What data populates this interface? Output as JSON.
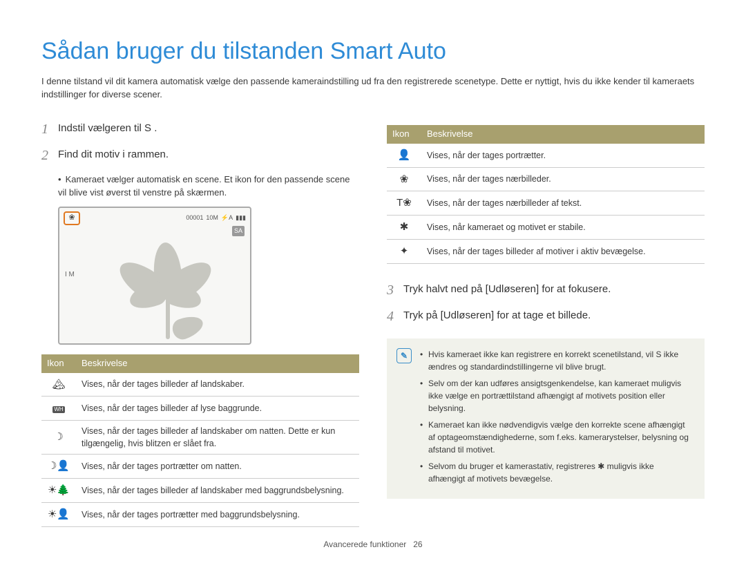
{
  "title": "Sådan bruger du tilstanden Smart Auto",
  "intro": "I denne tilstand vil dit kamera automatisk vælge den passende kameraindstilling ud fra den registrerede scenetype. Dette er nyttigt, hvis du ikke kender til kameraets indstillinger for diverse scener.",
  "steps": {
    "s1": {
      "num": "1",
      "text": "Indstil vælgeren til  S .",
      "mode_icon": "S"
    },
    "s2": {
      "num": "2",
      "text": "Find dit motiv i rammen."
    },
    "s2_bullet": "Kameraet vælger automatisk en scene. Et ikon for den passende scene vil blive vist øverst til venstre på skærmen.",
    "s3": {
      "num": "3",
      "text": "Tryk halvt ned på [Udløseren] for at fokusere."
    },
    "s4": {
      "num": "4",
      "text": "Tryk på [Udløseren] for at tage et billede."
    }
  },
  "preview": {
    "macro_glyph": "❀",
    "counter": "00001",
    "res": "10M",
    "flash": "⚡A",
    "battery": "▮▮▮",
    "sa": "SA",
    "leftmark": "I M"
  },
  "table_header": {
    "icon": "Ikon",
    "desc": "Beskrivelse"
  },
  "left_table": [
    {
      "icon": "🏔",
      "name": "landscape-icon",
      "desc": "Vises, når der tages billeder af landskaber."
    },
    {
      "icon": "WH",
      "name": "white-bg-icon",
      "desc": "Vises, når der tages billeder af lyse baggrunde."
    },
    {
      "icon": "☽",
      "name": "night-landscape-icon",
      "desc": "Vises, når der tages billeder af landskaber om natten. Dette er kun tilgængelig, hvis blitzen er slået fra."
    },
    {
      "icon": "☽👤",
      "name": "night-portrait-icon",
      "desc": "Vises, når der tages portrætter om natten."
    },
    {
      "icon": "☀🌲",
      "name": "backlight-landscape-icon",
      "desc": "Vises, når der tages billeder af landskaber med baggrundsbelysning."
    },
    {
      "icon": "☀👤",
      "name": "backlight-portrait-icon",
      "desc": "Vises, når der tages portrætter med baggrundsbelysning."
    }
  ],
  "right_table": [
    {
      "icon": "👤",
      "name": "portrait-icon",
      "desc": "Vises, når der tages portrætter."
    },
    {
      "icon": "❀",
      "name": "macro-icon",
      "desc": "Vises, når der tages nærbilleder."
    },
    {
      "icon": "T❀",
      "name": "text-macro-icon",
      "desc": "Vises, når der tages nærbilleder af tekst."
    },
    {
      "icon": "✱",
      "name": "tripod-icon",
      "desc": "Vises, når kameraet og motivet er stabile."
    },
    {
      "icon": "✦",
      "name": "action-icon",
      "desc": "Vises, når der tages billeder af motiver i aktiv bevægelse."
    }
  ],
  "notes": [
    "Hvis kameraet ikke kan registrere en korrekt scenetilstand, vil  S  ikke ændres og standardindstillingerne vil blive brugt.",
    "Selv om der kan udføres ansigtsgenkendelse, kan kameraet muligvis ikke vælge en portrættilstand afhængigt af motivets position eller belysning.",
    "Kameraet kan ikke nødvendigvis vælge den korrekte scene afhængigt af optageomstændighederne, som f.eks. kamerarystelser, belysning og afstand til motivet.",
    "Selvom du bruger et kamerastativ, registreres ✱ muligvis ikke afhængigt af motivets bevægelse."
  ],
  "note_inline_icons": {
    "sa": "S",
    "tripod": "✱"
  },
  "footer": {
    "section": "Avancerede funktioner",
    "page": "26"
  }
}
